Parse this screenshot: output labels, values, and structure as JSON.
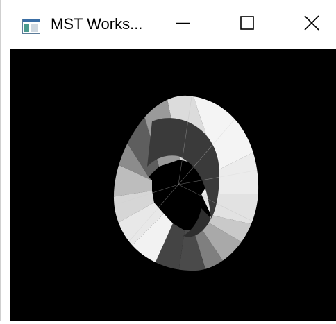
{
  "window": {
    "title": "MST Works...",
    "icon": "app-window-icon",
    "controls": {
      "minimize_icon": "minimize-icon",
      "maximize_icon": "maximize-icon",
      "close_icon": "close-icon"
    }
  },
  "viewport": {
    "background": "#000000",
    "content": "shaded-torus"
  }
}
